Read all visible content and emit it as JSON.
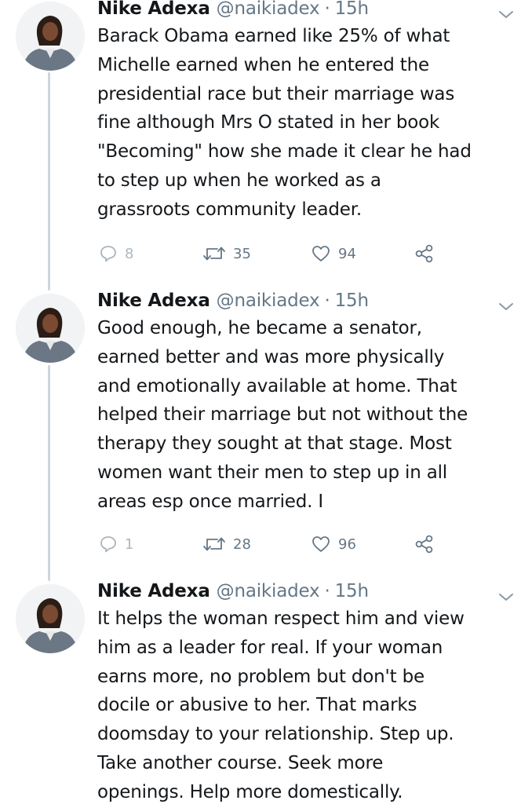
{
  "tweets": [
    {
      "author_name": "Nike Adexa",
      "handle": "@naikiadex",
      "separator": "·",
      "time": "15h",
      "text_lines": [
        "Barack Obama earned like 25% of what",
        "Michelle earned when he entered the",
        "presidential race but their marriage was",
        "fine although Mrs O stated in her book",
        "\"Becoming\" how she made it clear he had",
        "to step up when he worked as a",
        "grassroots community leader."
      ],
      "replies": "8",
      "retweets": "35",
      "likes": "94"
    },
    {
      "author_name": "Nike Adexa",
      "handle": "@naikiadex",
      "separator": "·",
      "time": "15h",
      "text_lines": [
        "Good enough, he became a senator,",
        "earned better and was more physically",
        "and emotionally available at home. That",
        "helped their marriage but not without the",
        "therapy they sought at that stage. Most",
        "women want their men to step up in all",
        "areas esp once married. I"
      ],
      "replies": "1",
      "retweets": "28",
      "likes": "96"
    },
    {
      "author_name": "Nike Adexa",
      "handle": "@naikiadex",
      "separator": "·",
      "time": "15h",
      "text_lines": [
        "It helps the woman respect him and view",
        "him as a leader for real. If your woman",
        "earns more, no problem but don't be",
        "docile or abusive to her. That marks",
        "doomsday to your relationship. Step up.",
        "Take another course. Seek more",
        "openings. Help more domestically."
      ]
    }
  ],
  "icons": {
    "reply": "reply-icon",
    "retweet": "retweet-icon",
    "like": "heart-icon",
    "share": "share-icon",
    "menu": "chevron-down-icon"
  },
  "colors": {
    "text": "#14171a",
    "secondary": "#657786",
    "thread_line": "#ccd6dd"
  }
}
